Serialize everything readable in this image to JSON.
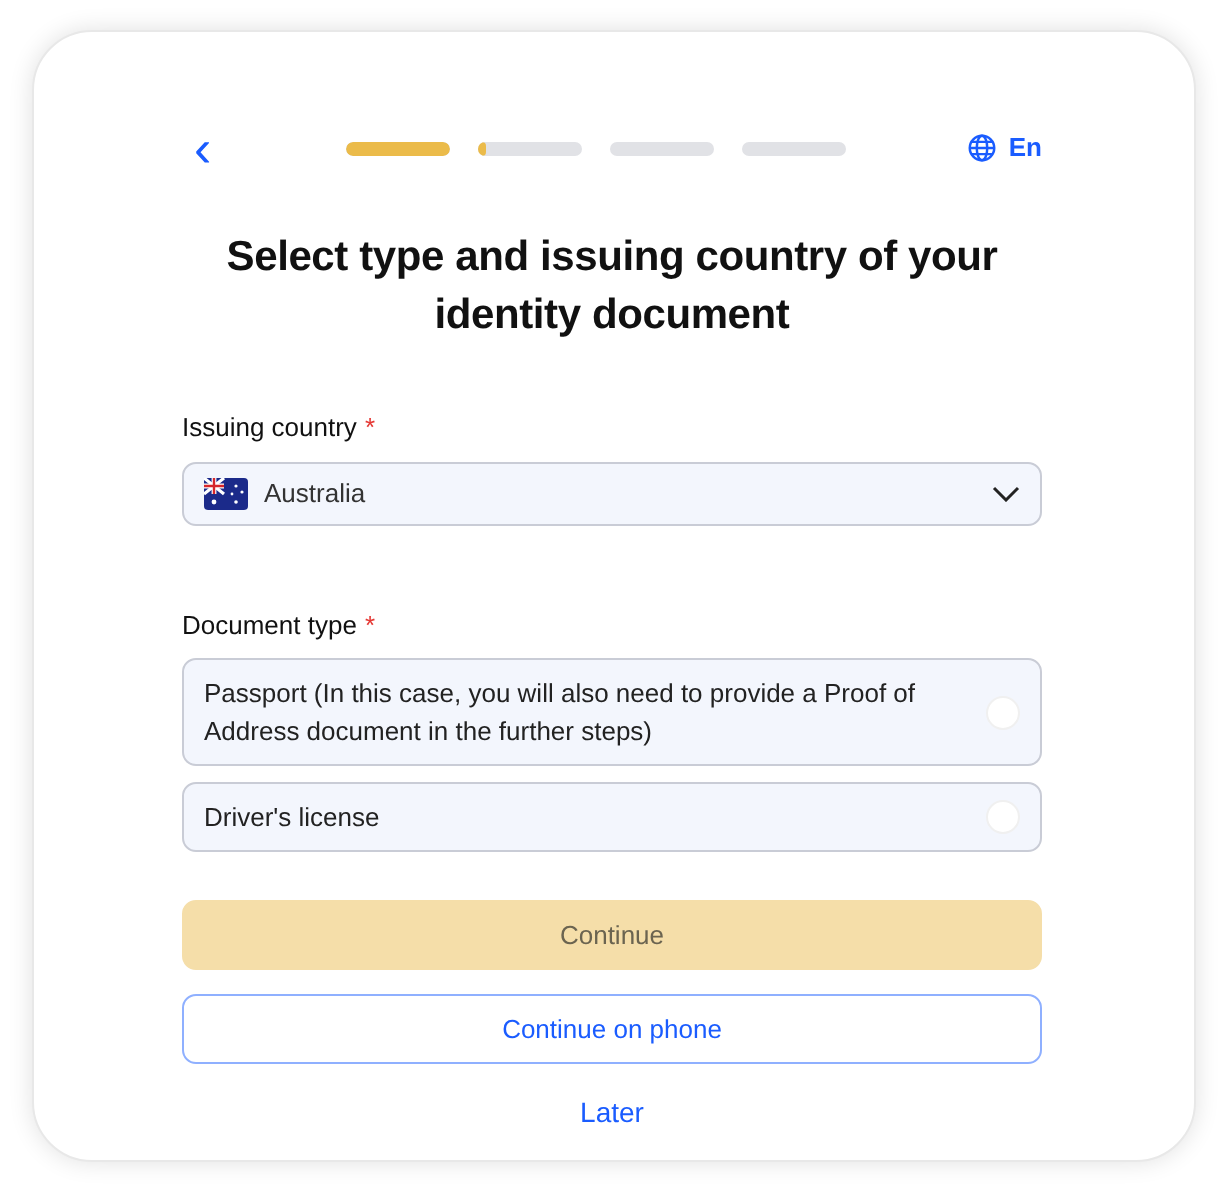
{
  "header": {
    "back": "‹",
    "language": "En",
    "progress": [
      {
        "level": 1
      },
      {
        "level": 0.08
      },
      {
        "level": 0
      },
      {
        "level": 0
      }
    ]
  },
  "title": "Select type and issuing country of your identity document",
  "country_field": {
    "label": "Issuing country",
    "required_mark": "*",
    "value": "Australia"
  },
  "document_type": {
    "label": "Document type",
    "required_mark": "*",
    "options": [
      {
        "label": "Passport (In this case, you will also need to provide a Proof of Address document in the further steps)",
        "selected": false
      },
      {
        "label": "Driver's license",
        "selected": false
      }
    ]
  },
  "buttons": [
    {
      "label": "Continue",
      "kind": "primary",
      "disabled": true
    },
    {
      "label": "Continue on phone",
      "kind": "outline",
      "disabled": false
    },
    {
      "label": "Later",
      "kind": "link",
      "disabled": false
    }
  ]
}
